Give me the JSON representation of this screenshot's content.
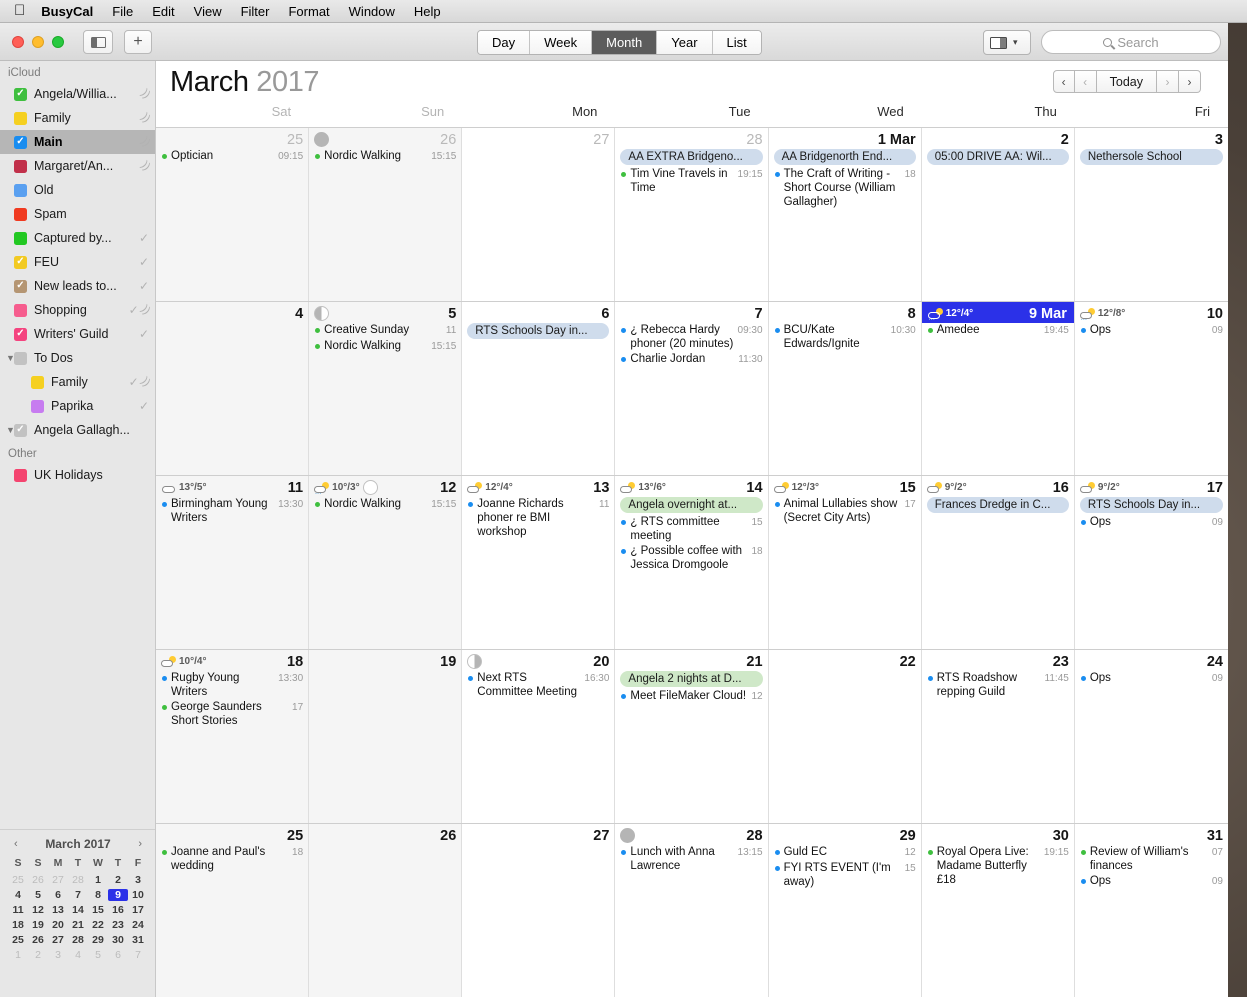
{
  "menubar": {
    "apple": "",
    "items": [
      "BusyCal",
      "File",
      "Edit",
      "View",
      "Filter",
      "Format",
      "Window",
      "Help"
    ]
  },
  "toolbar": {
    "sidebar_toggle": "sidebar-toggle",
    "add_label": "+",
    "views": [
      "Day",
      "Week",
      "Month",
      "Year",
      "List"
    ],
    "active_view": "Month",
    "search_placeholder": "Search",
    "view_mode": "view-mode"
  },
  "sidebar": {
    "sections": [
      {
        "title": "iCloud",
        "items": [
          {
            "label": "Angela/Willia...",
            "color": "#3fbf3f",
            "checked": true,
            "wifi": true,
            "tick": false
          },
          {
            "label": "Family",
            "color": "#f5d020",
            "checked": false,
            "wifi": true,
            "tick": false
          },
          {
            "label": "Main",
            "color": "#1a8df0",
            "checked": true,
            "wifi": true,
            "tick": false,
            "selected": true
          },
          {
            "label": "Margaret/An...",
            "color": "#c1304a",
            "checked": false,
            "wifi": true,
            "tick": false
          },
          {
            "label": "Old",
            "color": "#5aa0f0",
            "checked": false,
            "wifi": false,
            "tick": false
          },
          {
            "label": "Spam",
            "color": "#f03a20",
            "checked": false,
            "wifi": false,
            "tick": false
          },
          {
            "label": "Captured by...",
            "color": "#22c822",
            "checked": false,
            "wifi": false,
            "tick": true
          },
          {
            "label": "FEU",
            "color": "#f2ca23",
            "checked": true,
            "wifi": false,
            "tick": true
          },
          {
            "label": "New leads to...",
            "color": "#b59673",
            "checked": true,
            "wifi": false,
            "tick": true
          },
          {
            "label": "Shopping",
            "color": "#f65d8e",
            "checked": false,
            "wifi": true,
            "tick": true
          },
          {
            "label": "Writers' Guild",
            "color": "#f4447f",
            "checked": true,
            "wifi": false,
            "tick": true
          }
        ]
      }
    ],
    "todos": {
      "group_label": "To Dos",
      "items": [
        {
          "label": "Family",
          "color": "#f5d020",
          "wifi": true,
          "tick": true
        },
        {
          "label": "Paprika",
          "color": "#c77cf0",
          "wifi": false,
          "tick": true
        }
      ],
      "account_label": "Angela Gallagh..."
    },
    "other": {
      "title": "Other",
      "items": [
        {
          "label": "UK Holidays",
          "color": "#f4446f",
          "checked": false
        }
      ]
    },
    "minimonth": {
      "title": "March 2017",
      "prev": "‹",
      "next": "›",
      "dow": [
        "S",
        "S",
        "M",
        "T",
        "W",
        "T",
        "F"
      ],
      "weeks": [
        [
          {
            "n": "25",
            "out": true
          },
          {
            "n": "26",
            "out": true
          },
          {
            "n": "27",
            "out": true
          },
          {
            "n": "28",
            "out": true
          },
          {
            "n": "1"
          },
          {
            "n": "2"
          },
          {
            "n": "3"
          }
        ],
        [
          {
            "n": "4"
          },
          {
            "n": "5"
          },
          {
            "n": "6"
          },
          {
            "n": "7"
          },
          {
            "n": "8"
          },
          {
            "n": "9",
            "today": true
          },
          {
            "n": "10"
          }
        ],
        [
          {
            "n": "11"
          },
          {
            "n": "12"
          },
          {
            "n": "13"
          },
          {
            "n": "14"
          },
          {
            "n": "15"
          },
          {
            "n": "16"
          },
          {
            "n": "17"
          }
        ],
        [
          {
            "n": "18"
          },
          {
            "n": "19"
          },
          {
            "n": "20"
          },
          {
            "n": "21"
          },
          {
            "n": "22"
          },
          {
            "n": "23"
          },
          {
            "n": "24"
          }
        ],
        [
          {
            "n": "25"
          },
          {
            "n": "26"
          },
          {
            "n": "27"
          },
          {
            "n": "28"
          },
          {
            "n": "29"
          },
          {
            "n": "30"
          },
          {
            "n": "31"
          }
        ],
        [
          {
            "n": "1",
            "out": true
          },
          {
            "n": "2",
            "out": true
          },
          {
            "n": "3",
            "out": true
          },
          {
            "n": "4",
            "out": true
          },
          {
            "n": "5",
            "out": true
          },
          {
            "n": "6",
            "out": true
          },
          {
            "n": "7",
            "out": true
          }
        ]
      ]
    }
  },
  "calendar": {
    "month_name": "March",
    "year": "2017",
    "nav": {
      "first": "‹",
      "prev": "‹",
      "today": "Today",
      "next": "›",
      "last": "›"
    },
    "dow": [
      {
        "label": "Sat",
        "weekend": true
      },
      {
        "label": "Sun",
        "weekend": true
      },
      {
        "label": "Mon",
        "weekend": false
      },
      {
        "label": "Tue",
        "weekend": false
      },
      {
        "label": "Wed",
        "weekend": false
      },
      {
        "label": "Thu",
        "weekend": false
      },
      {
        "label": "Fri",
        "weekend": false
      }
    ],
    "weeks": [
      [
        {
          "num": "25",
          "out": true,
          "weekend": true,
          "events": [
            {
              "title": "Optician",
              "time": "09:15",
              "color": "#3fbf3f"
            }
          ]
        },
        {
          "num": "26",
          "out": true,
          "weekend": true,
          "moon": "new",
          "events": [
            {
              "title": "Nordic Walking",
              "time": "15:15",
              "color": "#3fbf3f"
            }
          ]
        },
        {
          "num": "27",
          "out": true,
          "events": []
        },
        {
          "num": "28",
          "out": true,
          "events": [
            {
              "title": "AA EXTRA Bridgeno...",
              "banner": true
            },
            {
              "title": "Tim Vine Travels in Time",
              "time": "19:15",
              "color": "#3fbf3f"
            }
          ]
        },
        {
          "num": "1 Mar",
          "events": [
            {
              "title": "AA Bridgenorth End...",
              "banner": true
            },
            {
              "title": "The Craft of Writing - Short Course (William Gallagher)",
              "time": "18",
              "color": "#1a8df0"
            }
          ]
        },
        {
          "num": "2",
          "events": [
            {
              "title": "05:00 DRIVE AA: Wil...",
              "banner": true
            }
          ]
        },
        {
          "num": "3",
          "events": [
            {
              "title": "Nethersole School",
              "banner": true
            }
          ]
        }
      ],
      [
        {
          "num": "4",
          "weekend": true,
          "events": []
        },
        {
          "num": "5",
          "weekend": true,
          "moon": "half",
          "events": [
            {
              "title": "Creative Sunday",
              "time": "11",
              "color": "#3fbf3f"
            },
            {
              "title": "Nordic Walking",
              "time": "15:15",
              "color": "#3fbf3f"
            }
          ]
        },
        {
          "num": "6",
          "events": [
            {
              "title": "RTS Schools Day in...",
              "banner": true
            }
          ]
        },
        {
          "num": "7",
          "events": [
            {
              "title": "¿ Rebecca Hardy phoner (20 minutes)",
              "time": "09:30",
              "color": "#1a8df0"
            },
            {
              "title": "Charlie Jordan",
              "time": "11:30",
              "color": "#1a8df0"
            }
          ]
        },
        {
          "num": "8",
          "events": [
            {
              "title": "BCU/Kate Edwards/Ignite",
              "time": "10:30",
              "color": "#1a8df0"
            }
          ]
        },
        {
          "num": "9 Mar",
          "today": true,
          "weather": {
            "icon": "cloud-rain",
            "temps": "12°/4°"
          },
          "events": [
            {
              "title": "Amedee",
              "time": "19:45",
              "color": "#3fbf3f"
            }
          ]
        },
        {
          "num": "10",
          "weather": {
            "icon": "cloud-rain",
            "temps": "12°/8°"
          },
          "events": [
            {
              "title": "Ops",
              "time": "09",
              "color": "#1a8df0"
            }
          ]
        }
      ],
      [
        {
          "num": "11",
          "weekend": true,
          "weather": {
            "icon": "cloud",
            "temps": "13°/5°"
          },
          "events": [
            {
              "title": "Birmingham Young Writers",
              "time": "13:30",
              "color": "#1a8df0"
            }
          ]
        },
        {
          "num": "12",
          "weekend": true,
          "moon": "full",
          "weather": {
            "icon": "cloud-rain-sun",
            "temps": "10°/3°"
          },
          "events": [
            {
              "title": "Nordic Walking",
              "time": "15:15",
              "color": "#3fbf3f"
            }
          ]
        },
        {
          "num": "13",
          "weather": {
            "icon": "sun-cloud",
            "temps": "12°/4°"
          },
          "events": [
            {
              "title": "Joanne Richards phoner re BMI workshop",
              "time": "11",
              "color": "#1a8df0"
            }
          ]
        },
        {
          "num": "14",
          "weather": {
            "icon": "sun-cloud",
            "temps": "13°/6°"
          },
          "events": [
            {
              "title": "Angela overnight at...",
              "banner": true,
              "bannerColor": "green"
            },
            {
              "title": "¿ RTS committee meeting",
              "time": "15",
              "color": "#1a8df0"
            },
            {
              "title": "¿ Possible coffee with Jessica Dromgoole",
              "time": "18",
              "color": "#1a8df0"
            }
          ]
        },
        {
          "num": "15",
          "weather": {
            "icon": "sun-cloud",
            "temps": "12°/3°"
          },
          "events": [
            {
              "title": "Animal Lullabies show (Secret City Arts)",
              "time": "17",
              "color": "#1a8df0"
            }
          ]
        },
        {
          "num": "16",
          "weather": {
            "icon": "sun-cloud",
            "temps": "9°/2°"
          },
          "events": [
            {
              "title": "Frances Dredge in C...",
              "banner": true
            }
          ]
        },
        {
          "num": "17",
          "weather": {
            "icon": "sun-cloud",
            "temps": "9°/2°"
          },
          "events": [
            {
              "title": "RTS Schools Day in...",
              "banner": true
            },
            {
              "title": "Ops",
              "time": "09",
              "color": "#1a8df0"
            }
          ]
        }
      ],
      [
        {
          "num": "18",
          "weekend": true,
          "weather": {
            "icon": "sun-cloud",
            "temps": "10°/4°"
          },
          "events": [
            {
              "title": "Rugby Young Writers",
              "time": "13:30",
              "color": "#1a8df0"
            },
            {
              "title": "George Saunders Short Stories",
              "time": "17",
              "color": "#3fbf3f"
            }
          ]
        },
        {
          "num": "19",
          "weekend": true,
          "events": []
        },
        {
          "num": "20",
          "moon": "halfr",
          "events": [
            {
              "title": "Next RTS Committee Meeting",
              "time": "16:30",
              "color": "#1a8df0"
            }
          ]
        },
        {
          "num": "21",
          "events": [
            {
              "title": "Angela 2 nights at D...",
              "banner": true,
              "bannerColor": "green"
            },
            {
              "title": "Meet FileMaker Cloud!",
              "time": "12",
              "color": "#1a8df0"
            }
          ]
        },
        {
          "num": "22",
          "events": []
        },
        {
          "num": "23",
          "events": [
            {
              "title": "RTS Roadshow repping Guild",
              "time": "11:45",
              "color": "#1a8df0"
            }
          ]
        },
        {
          "num": "24",
          "events": [
            {
              "title": "Ops",
              "time": "09",
              "color": "#1a8df0"
            }
          ]
        }
      ],
      [
        {
          "num": "25",
          "weekend": true,
          "events": [
            {
              "title": "Joanne and Paul's wedding",
              "time": "18",
              "color": "#3fbf3f"
            }
          ]
        },
        {
          "num": "26",
          "weekend": true,
          "events": []
        },
        {
          "num": "27",
          "events": []
        },
        {
          "num": "28",
          "moon": "new",
          "events": [
            {
              "title": "Lunch with Anna Lawrence",
              "time": "13:15",
              "color": "#1a8df0"
            }
          ]
        },
        {
          "num": "29",
          "events": [
            {
              "title": "Guld EC",
              "time": "12",
              "color": "#1a8df0"
            },
            {
              "title": "FYI RTS EVENT (I'm away)",
              "time": "15",
              "color": "#1a8df0"
            }
          ]
        },
        {
          "num": "30",
          "events": [
            {
              "title": "Royal Opera Live: Madame Butterfly £18",
              "time": "19:15",
              "color": "#3fbf3f"
            }
          ]
        },
        {
          "num": "31",
          "events": [
            {
              "title": "Review of William's finances",
              "time": "07",
              "color": "#3fbf3f"
            },
            {
              "title": "Ops",
              "time": "09",
              "color": "#1a8df0"
            }
          ]
        }
      ]
    ]
  }
}
